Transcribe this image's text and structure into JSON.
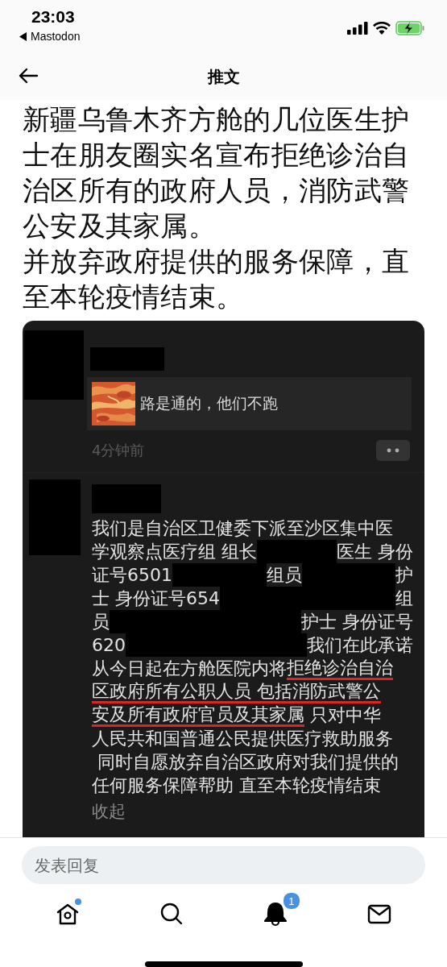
{
  "status_bar": {
    "time": "23:03",
    "back_app": "Mastodon",
    "charging": true
  },
  "header": {
    "title": "推文"
  },
  "tweet": {
    "paragraphs": [
      "新疆乌鲁木齐方舱的几位医生护士在朋友圈实名宣布拒绝诊治自治区所有的政府人员，消防武警公安及其家属。",
      "并放弃政府提供的服务保障，直至本轮疫情结束。"
    ]
  },
  "embedded_screenshot": {
    "posts": [
      {
        "kind": "link",
        "link_preview": {
          "kind": "picture",
          "text": "路是通的，他们不跑"
        },
        "time": "4分钟前"
      },
      {
        "kind": "text",
        "lines": [
          [
            {
              "kind": "text",
              "text": "我们是自治区卫健委下派至沙区集中医"
            }
          ],
          [
            {
              "kind": "text",
              "text": "学观察点医疗组 组长"
            },
            {
              "kind": "redacted"
            },
            {
              "kind": "text",
              "text": "医生 身份"
            }
          ],
          [
            {
              "kind": "text",
              "text": "证号6501"
            },
            {
              "kind": "redacted"
            },
            {
              "kind": "text",
              "text": "组员"
            },
            {
              "kind": "redacted"
            },
            {
              "kind": "text",
              "text": "护"
            }
          ],
          [
            {
              "kind": "text",
              "text": "士 身份证号654"
            },
            {
              "kind": "redacted"
            },
            {
              "kind": "text",
              "text": "组"
            }
          ],
          [
            {
              "kind": "text",
              "text": "员"
            },
            {
              "kind": "redacted"
            },
            {
              "kind": "text",
              "text": "护士 身份证号"
            }
          ],
          [
            {
              "kind": "text",
              "text": "620"
            },
            {
              "kind": "redacted"
            },
            {
              "kind": "text",
              "text": "我们在此承诺"
            }
          ],
          [
            {
              "kind": "text",
              "text": "从今日起在方舱医院内将"
            },
            {
              "kind": "underlined",
              "text": "拒绝诊治自治"
            }
          ],
          [
            {
              "kind": "underlined",
              "text": "区政府所有公职人员 包括消防武警公"
            }
          ],
          [
            {
              "kind": "underlined",
              "text": "安及所有政府官员及其家属"
            },
            {
              "kind": "text",
              "text": " 只对中华"
            }
          ],
          [
            {
              "kind": "text",
              "text": "人民共和国普通公民提供医疗救助服务"
            }
          ],
          [
            {
              "kind": "text",
              "text": " 同时自愿放弃自治区政府对我们提供的"
            }
          ],
          [
            {
              "kind": "text",
              "text": "任何服务保障帮助 直至本轮疫情结束"
            }
          ]
        ],
        "collapse": "收起"
      }
    ]
  },
  "reply_field": {
    "placeholder": "发表回复"
  },
  "tab_bar": {
    "items": [
      {
        "kind": "home",
        "selected": false,
        "unread": true
      },
      {
        "kind": "search",
        "selected": false,
        "unread": false
      },
      {
        "kind": "notifications",
        "selected": true,
        "unread": false,
        "badge": "1"
      },
      {
        "kind": "messages",
        "selected": false,
        "unread": false
      }
    ]
  }
}
